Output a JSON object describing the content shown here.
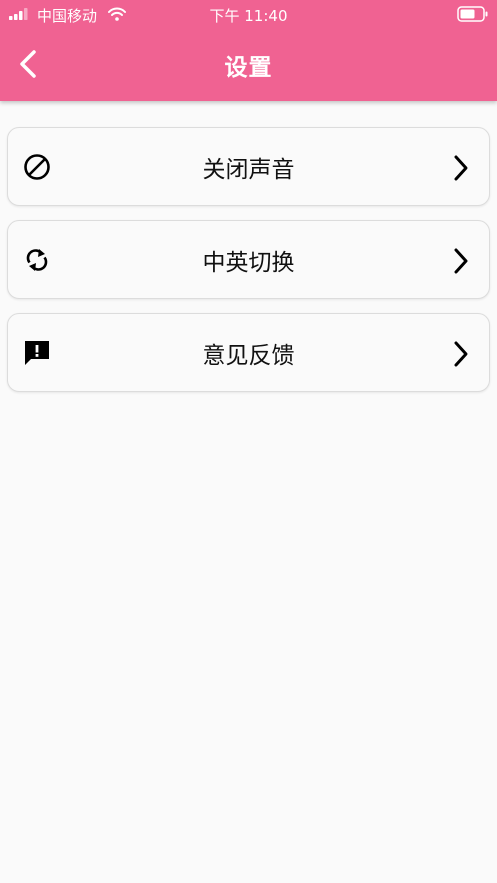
{
  "status_bar": {
    "carrier": "中国移动",
    "time": "下午 11:40"
  },
  "header": {
    "title": "设置"
  },
  "menu": {
    "items": [
      {
        "label": "关闭声音",
        "icon": "block-icon"
      },
      {
        "label": "中英切换",
        "icon": "sync-icon"
      },
      {
        "label": "意见反馈",
        "icon": "feedback-icon"
      }
    ]
  },
  "colors": {
    "header_background": "#f06292",
    "page_background": "#fafafa",
    "text": "#111111"
  }
}
